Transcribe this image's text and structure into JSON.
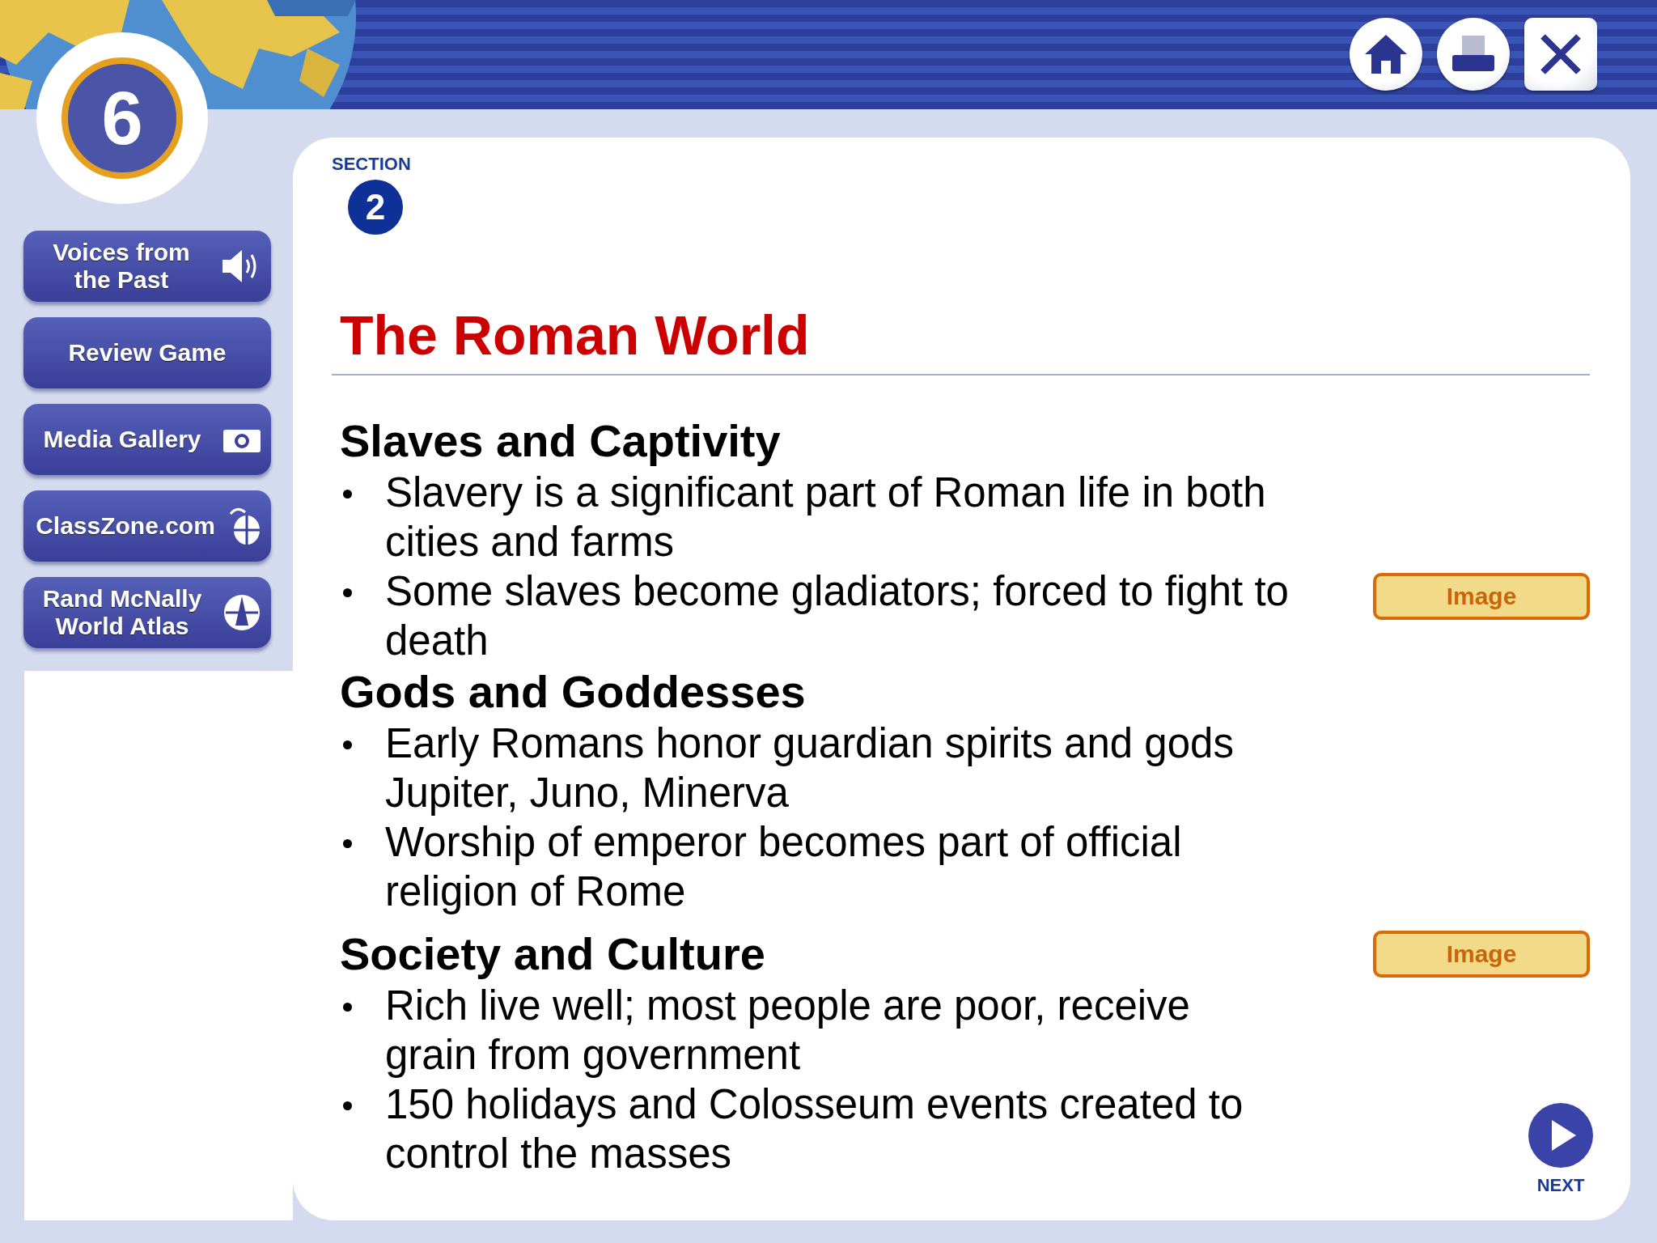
{
  "chapter": {
    "number": "6"
  },
  "toolbar": [
    {
      "kind": "home"
    },
    {
      "kind": "print"
    },
    {
      "kind": "close"
    }
  ],
  "sidebar": {
    "buttons": [
      {
        "label": "Voices from the Past",
        "kind": "audio"
      },
      {
        "label": "Review Game",
        "kind": "plain"
      },
      {
        "label": "Media Gallery",
        "kind": "camera"
      },
      {
        "label": "ClassZone.com",
        "kind": "web"
      },
      {
        "label": "Rand McNally World Atlas",
        "kind": "atlas"
      }
    ]
  },
  "section": {
    "label": "SECTION",
    "number": "2"
  },
  "title": "The Roman World",
  "topics": [
    {
      "heading": "Slaves and Captivity",
      "bullets": [
        {
          "text": "Slavery is a significant part of Roman life in both cities and farms"
        },
        {
          "text": "Some slaves become gladiators; forced to fight to death",
          "action": "Image"
        }
      ]
    },
    {
      "heading": "Gods and Goddesses",
      "bullets": [
        {
          "text": "Early Romans honor guardian spirits and gods Jupiter, Juno, Minerva"
        },
        {
          "text": "Worship of emperor becomes part of official religion of Rome"
        }
      ]
    },
    {
      "heading": "Society and Culture",
      "heading_action": "Image",
      "bullets": [
        {
          "text": "Rich live well; most people are poor, receive grain from government"
        },
        {
          "text": "150 holidays and Colosseum events created to control the masses"
        }
      ]
    }
  ],
  "next": {
    "label": "NEXT"
  }
}
